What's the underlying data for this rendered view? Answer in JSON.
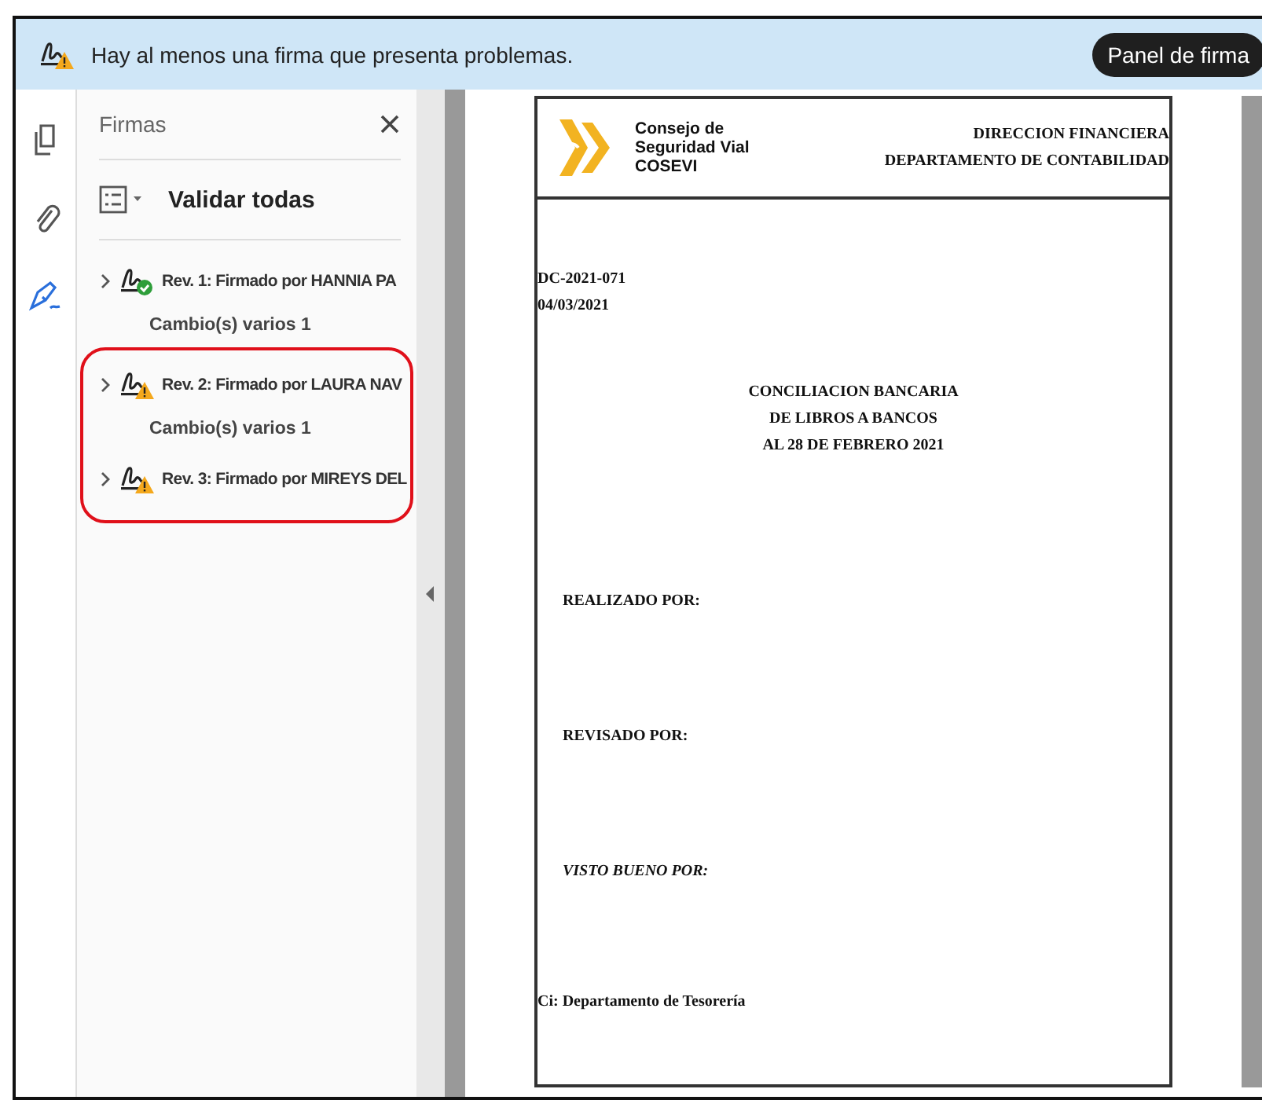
{
  "banner": {
    "message": "Hay al menos una firma que presenta problemas.",
    "button": "Panel de firma"
  },
  "rail": [
    {
      "kind": "pages",
      "selected": false
    },
    {
      "kind": "attachments",
      "selected": false
    },
    {
      "kind": "signatures",
      "selected": true
    }
  ],
  "panel": {
    "title": "Firmas",
    "validate": "Validar todas",
    "signatures": [
      {
        "kind": "valid",
        "label": "Rev. 1: Firmado por HANNIA PA",
        "detail": "Cambio(s) varios 1",
        "highlighted": false
      },
      {
        "kind": "warning",
        "label": "Rev. 2: Firmado por LAURA NAV",
        "detail": "Cambio(s) varios 1",
        "highlighted": true
      },
      {
        "kind": "warning",
        "label": "Rev. 3: Firmado por MIREYS DEL",
        "highlighted": true
      }
    ]
  },
  "document": {
    "org": [
      "Consejo de",
      "Seguridad Vial",
      "COSEVI"
    ],
    "header_right": [
      "DIRECCION FINANCIERA",
      "DEPARTAMENTO DE CONTABILIDAD"
    ],
    "ref": [
      "DC-2021-071",
      "04/03/2021"
    ],
    "title": [
      "CONCILIACION BANCARIA",
      "DE LIBROS A BANCOS",
      "AL 28 DE FEBRERO 2021"
    ],
    "fields": [
      {
        "label": "REALIZADO POR:",
        "italic": false
      },
      {
        "label": "REVISADO POR:",
        "italic": false
      },
      {
        "label": "VISTO BUENO POR:",
        "italic": true
      }
    ],
    "cc": "Ci:  Departamento de Tesorería"
  }
}
